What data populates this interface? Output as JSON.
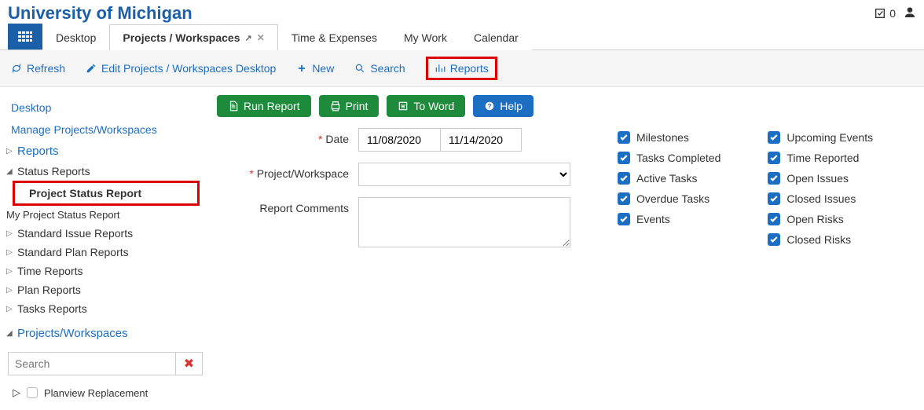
{
  "header": {
    "title": "University of Michigan",
    "badge_count": "0"
  },
  "tabs": {
    "desktop": "Desktop",
    "projects": "Projects / Workspaces",
    "time": "Time & Expenses",
    "mywork": "My Work",
    "calendar": "Calendar"
  },
  "toolbar": {
    "refresh": "Refresh",
    "edit_desktop": "Edit Projects / Workspaces Desktop",
    "new": "New",
    "search": "Search",
    "reports": "Reports"
  },
  "sidebar": {
    "desktop": "Desktop",
    "manage": "Manage Projects/Workspaces",
    "reports": "Reports",
    "status_reports": "Status Reports",
    "project_status_report": "Project Status Report",
    "my_project_status_report": "My Project Status Report",
    "standard_issue": "Standard Issue Reports",
    "standard_plan": "Standard Plan Reports",
    "time_reports": "Time Reports",
    "plan_reports": "Plan Reports",
    "tasks_reports": "Tasks Reports",
    "projects_workspaces": "Projects/Workspaces",
    "search_placeholder": "Search",
    "planview": "Planview Replacement"
  },
  "buttons": {
    "run_report": "Run Report",
    "print": "Print",
    "to_word": "To Word",
    "help": "Help"
  },
  "form": {
    "date_label": "Date",
    "date_from": "11/08/2020",
    "date_to": "11/14/2020",
    "project_label": "Project/Workspace",
    "comments_label": "Report Comments"
  },
  "checks": {
    "col1": {
      "milestones": "Milestones",
      "tasks_completed": "Tasks Completed",
      "active_tasks": "Active Tasks",
      "overdue_tasks": "Overdue Tasks",
      "events": "Events"
    },
    "col2": {
      "upcoming_events": "Upcoming Events",
      "time_reported": "Time Reported",
      "open_issues": "Open Issues",
      "closed_issues": "Closed Issues",
      "open_risks": "Open Risks",
      "closed_risks": "Closed Risks"
    }
  }
}
